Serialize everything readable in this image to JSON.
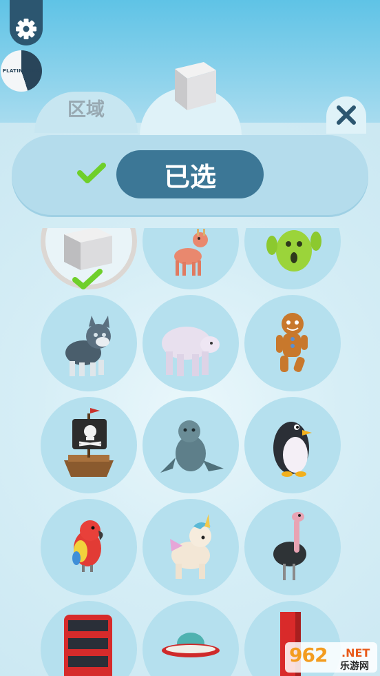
{
  "header": {
    "region_tab_label": "区域",
    "mods_badge_text": "PLATINMODS"
  },
  "panel": {
    "selected_label": "已选"
  },
  "grid": {
    "items": [
      {
        "name": "white-cube",
        "selected": true
      },
      {
        "name": "deer"
      },
      {
        "name": "cactus"
      },
      {
        "name": "wolf"
      },
      {
        "name": "polar-bear"
      },
      {
        "name": "gingerbread-man"
      },
      {
        "name": "pirate-ship"
      },
      {
        "name": "seal"
      },
      {
        "name": "penguin"
      },
      {
        "name": "parrot"
      },
      {
        "name": "unicorn"
      },
      {
        "name": "ostrich"
      },
      {
        "name": "double-decker-bus"
      },
      {
        "name": "ufo"
      },
      {
        "name": "red-tower"
      }
    ]
  },
  "watermark": {
    "number": "962",
    "suffix": ".NET",
    "site": "乐游网"
  },
  "colors": {
    "accent": "#3c7796",
    "settings": "#2c5670",
    "check": "#6fcf2a"
  }
}
